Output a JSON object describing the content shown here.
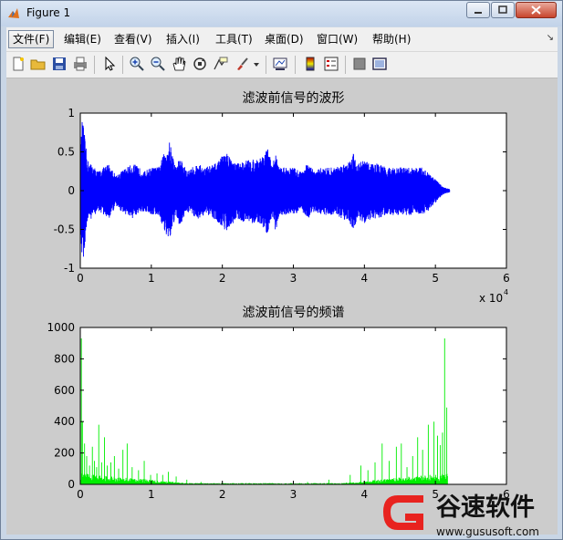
{
  "window": {
    "title": "Figure 1"
  },
  "menu": [
    {
      "label": "文件(F)",
      "active": true
    },
    {
      "label": "编辑(E)"
    },
    {
      "label": "查看(V)"
    },
    {
      "label": "插入(I)"
    },
    {
      "label": "工具(T)"
    },
    {
      "label": "桌面(D)"
    },
    {
      "label": "窗口(W)"
    },
    {
      "label": "帮助(H)"
    }
  ],
  "toolbar": {
    "icons": [
      "new-file-icon",
      "open-folder-icon",
      "save-icon",
      "print-icon",
      "pointer-icon",
      "zoom-in-icon",
      "zoom-out-icon",
      "pan-hand-icon",
      "rotate-3d-icon",
      "data-cursor-icon",
      "brush-icon",
      "dropdown-arrow-icon",
      "link-plot-icon",
      "colorbar-icon",
      "legend-icon",
      "hide-plot-tools-icon",
      "show-plot-tools-icon"
    ]
  },
  "colors": {
    "waveform": "#0000ff",
    "spectrum": "#00ee00",
    "figure_bg": "#cccccc",
    "axes_bg": "#ffffff"
  },
  "chart_data": [
    {
      "type": "line",
      "title": "滤波前信号的波形",
      "xlim": [
        0,
        60000
      ],
      "ylim": [
        -1,
        1
      ],
      "xticks": [
        0,
        1,
        2,
        3,
        4,
        5,
        6
      ],
      "yticks": [
        -1,
        -0.5,
        0,
        0.5,
        1
      ],
      "xtick_labels": [
        "0",
        "1",
        "2",
        "3",
        "4",
        "5",
        "6"
      ],
      "ytick_labels": [
        "-1",
        "-0.5",
        "0",
        "0.5",
        "1"
      ],
      "x_exponent_label": "x 10",
      "x_exponent_power": "4",
      "series": [
        {
          "color": "#0000ff",
          "envelope_x": [
            0,
            300,
            1000,
            2500,
            4000,
            5000,
            6500,
            7500,
            9000,
            10000,
            11000,
            12500,
            13500,
            14000,
            15000,
            16500,
            17500,
            19000,
            20500,
            22000,
            23500,
            25000,
            26500,
            27000,
            27500,
            28000,
            29000,
            30000,
            31000,
            32000,
            33000,
            34000,
            35000,
            36000,
            37000,
            38000,
            38500,
            39000,
            40000,
            41000,
            42000,
            43000,
            44000,
            45000,
            46000,
            47000,
            48000,
            49000,
            50000,
            51000,
            52000
          ],
          "envelope_y": [
            0.5,
            0.95,
            0.4,
            0.25,
            0.35,
            0.2,
            0.3,
            0.35,
            0.25,
            0.3,
            0.3,
            0.65,
            0.3,
            0.45,
            0.25,
            0.35,
            0.3,
            0.35,
            0.5,
            0.35,
            0.4,
            0.4,
            0.55,
            0.3,
            0.5,
            0.3,
            0.3,
            0.3,
            0.25,
            0.35,
            0.25,
            0.3,
            0.3,
            0.3,
            0.35,
            0.4,
            0.5,
            0.35,
            0.4,
            0.35,
            0.35,
            0.3,
            0.3,
            0.3,
            0.3,
            0.3,
            0.3,
            0.25,
            0.15,
            0.05,
            0.02
          ]
        }
      ]
    },
    {
      "type": "line",
      "title": "滤波前信号的频谱",
      "xlim": [
        0,
        60000
      ],
      "ylim": [
        0,
        1000
      ],
      "xticks": [
        0,
        1,
        2,
        3,
        4,
        5,
        6
      ],
      "yticks": [
        0,
        200,
        400,
        600,
        800,
        1000
      ],
      "xtick_labels": [
        "0",
        "1",
        "2",
        "3",
        "4",
        "5",
        "6"
      ],
      "ytick_labels": [
        "0",
        "200",
        "400",
        "600",
        "800",
        "1000"
      ],
      "series": [
        {
          "color": "#00ee00",
          "peaks_x": [
            150,
            300,
            600,
            900,
            1300,
            1700,
            2000,
            2300,
            2600,
            3000,
            3400,
            3800,
            4300,
            4800,
            5400,
            6000,
            6600,
            7300,
            8200,
            9000,
            9900,
            10800,
            11600,
            12400,
            13500,
            15000,
            17000,
            20000,
            26000,
            32000,
            35000,
            38000,
            39500,
            40500,
            41500,
            42500,
            43500,
            44500,
            45200,
            46000,
            46800,
            47500,
            48200,
            49000,
            49800,
            50300,
            50700,
            51000,
            51300,
            51600
          ],
          "peaks_y": [
            930,
            400,
            260,
            180,
            120,
            240,
            150,
            110,
            380,
            140,
            300,
            120,
            140,
            180,
            100,
            220,
            260,
            110,
            90,
            150,
            60,
            70,
            60,
            80,
            50,
            30,
            15,
            8,
            8,
            15,
            30,
            60,
            120,
            90,
            140,
            260,
            150,
            240,
            260,
            110,
            180,
            300,
            220,
            380,
            400,
            310,
            250,
            330,
            930,
            490
          ],
          "baseline": 40
        }
      ]
    }
  ],
  "watermark": {
    "brand": "谷速软件",
    "url": "www.gususoft.com"
  }
}
